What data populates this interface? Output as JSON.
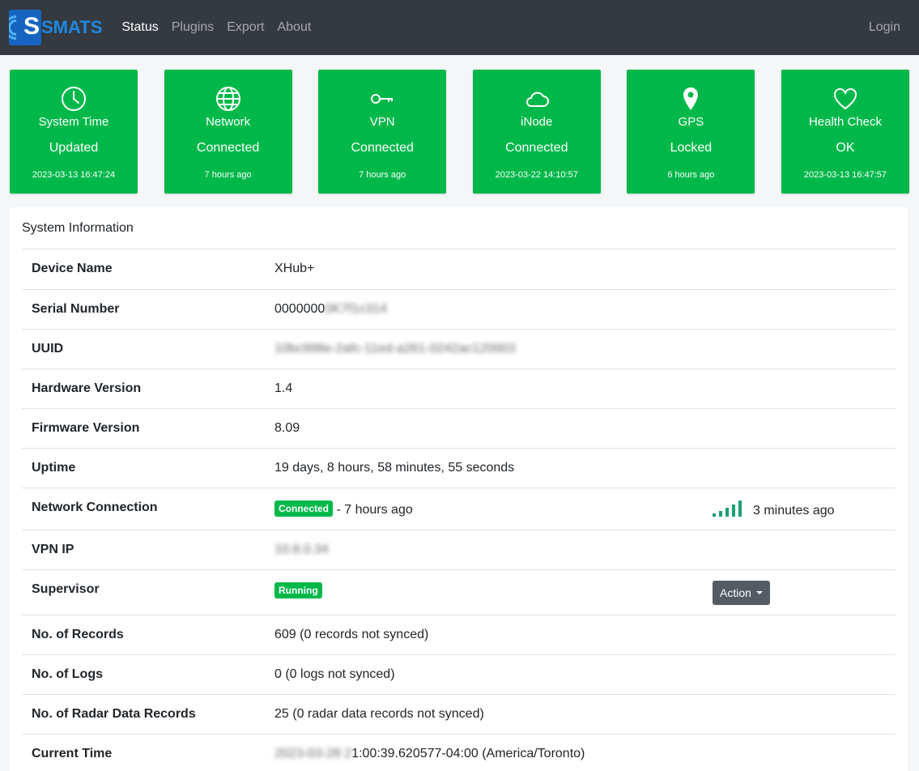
{
  "nav": {
    "logo_text": "SMATS",
    "links": [
      "Status",
      "Plugins",
      "Export",
      "About"
    ],
    "login": "Login"
  },
  "tiles": [
    {
      "icon": "clock-icon",
      "label": "System Time",
      "status": "Updated",
      "time": "2023-03-13 16:47:24"
    },
    {
      "icon": "globe-icon",
      "label": "Network",
      "status": "Connected",
      "time": "7 hours ago"
    },
    {
      "icon": "key-icon",
      "label": "VPN",
      "status": "Connected",
      "time": "7 hours ago"
    },
    {
      "icon": "cloud-icon",
      "label": "iNode",
      "status": "Connected",
      "time": "2023-03-22 14:10:57"
    },
    {
      "icon": "location-pin-icon",
      "label": "GPS",
      "status": "Locked",
      "time": "6 hours ago"
    },
    {
      "icon": "heart-icon",
      "label": "Health Check",
      "status": "OK",
      "time": "2023-03-13 16:47:57"
    }
  ],
  "system_info": {
    "title": "System Information",
    "device_name": {
      "label": "Device Name",
      "value": "XHub+"
    },
    "serial": {
      "label": "Serial Number",
      "value": "0000000",
      "value_blurred": "0K7f1c314"
    },
    "uuid": {
      "label": "UUID",
      "value_blurred": "10bc998e-2afc-11ed-a261-0242ac120003"
    },
    "hardware": {
      "label": "Hardware Version",
      "value": "1.4"
    },
    "firmware": {
      "label": "Firmware Version",
      "value": "8.09"
    },
    "uptime": {
      "label": "Uptime",
      "value": "19 days, 8 hours, 58 minutes, 55 seconds"
    },
    "network": {
      "label": "Network Connection",
      "badge": "Connected",
      "value": "- 7 hours ago",
      "signal_time": "3 minutes ago",
      "signal_bars": 5
    },
    "vpn_ip": {
      "label": "VPN IP",
      "value_blurred": "10.8.0.34"
    },
    "supervisor": {
      "label": "Supervisor",
      "badge": "Running",
      "action": "Action"
    },
    "records": {
      "label": "No. of Records",
      "value": "609 (0 records not synced)"
    },
    "logs": {
      "label": "No. of Logs",
      "value": "0 (0 logs not synced)"
    },
    "radar": {
      "label": "No. of Radar Data Records",
      "value": "25 (0 radar data records not synced)"
    },
    "current_time": {
      "label": "Current Time",
      "value_blurred": "2023-03-28 2",
      "value": "1:00:39.620577-04:00 (America/Toronto)"
    }
  },
  "colors": {
    "tile": "#00b84a",
    "navbar": "#343a40",
    "signal": "#1aa174"
  }
}
